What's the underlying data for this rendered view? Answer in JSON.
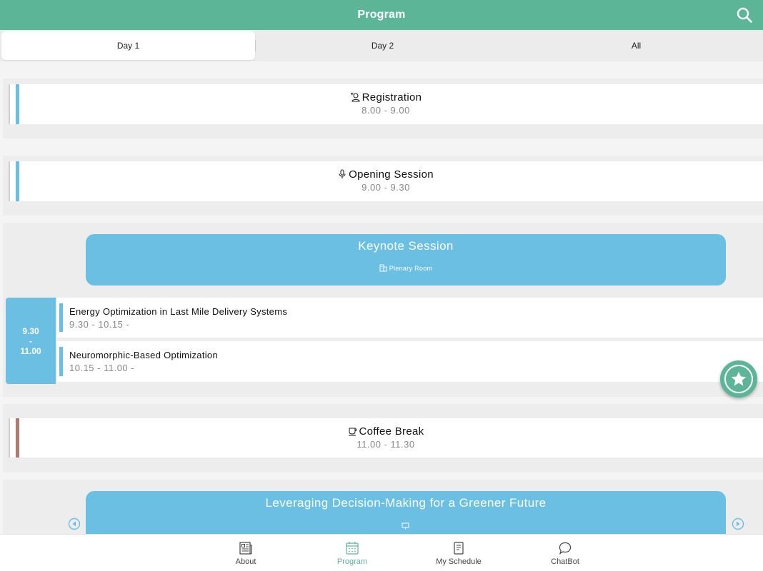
{
  "header": {
    "title": "Program",
    "search_icon": "search-icon"
  },
  "tabs": [
    {
      "label": "Day 1",
      "active": true
    },
    {
      "label": "Day 2",
      "active": false
    },
    {
      "label": "All",
      "active": false
    }
  ],
  "program": {
    "registration": {
      "title": "Registration",
      "time": "8.00 - 9.00",
      "icon": "person-add-icon"
    },
    "opening": {
      "title": "Opening Session",
      "time": "9.00 - 9.30",
      "icon": "microphone-icon"
    },
    "keynote": {
      "title": "Keynote Session",
      "room": "Plenary Room",
      "time_block": {
        "start": "9.30",
        "dash": "-",
        "end": "11.00"
      },
      "talks": [
        {
          "title": "Energy Optimization in Last Mile Delivery Systems",
          "time": "9.30 - 10.15 -"
        },
        {
          "title": "Neuromorphic-Based Optimization",
          "time": "10.15 - 11.00 -"
        }
      ]
    },
    "coffee": {
      "title": "Coffee Break",
      "time": "11.00 - 11.30",
      "icon": "coffee-cup-icon"
    },
    "greener": {
      "title": "Leveraging Decision-Making for a Greener Future",
      "icon": "presentation-icon"
    }
  },
  "bottom_nav": [
    {
      "label": "About",
      "icon": "newspaper-icon",
      "active": false
    },
    {
      "label": "Program",
      "icon": "calendar-icon",
      "active": true
    },
    {
      "label": "My Schedule",
      "icon": "document-icon",
      "active": false
    },
    {
      "label": "ChatBot",
      "icon": "chat-bubble-icon",
      "active": false
    }
  ],
  "colors": {
    "primary": "#5cb597",
    "session_blue": "#6bbfe3",
    "break_brown": "#b07a6e"
  }
}
